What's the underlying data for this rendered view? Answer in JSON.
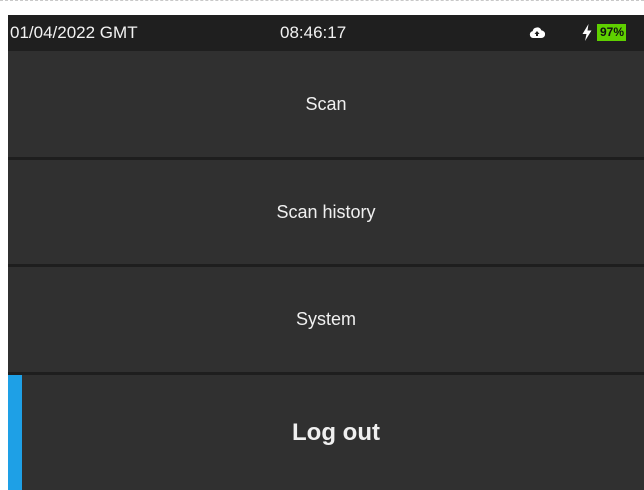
{
  "status_bar": {
    "date": "01/04/2022 GMT",
    "time": "08:46:17",
    "cloud_icon": "cloud-icon",
    "charging_icon": "lightning-bolt-icon",
    "battery_level": "97%",
    "battery_color": "#5fd000"
  },
  "menu": {
    "items": [
      {
        "label": "Scan"
      },
      {
        "label": "Scan history"
      },
      {
        "label": "System"
      },
      {
        "label": "Log out",
        "selected": true
      }
    ],
    "selection_color": "#1ea0e6"
  }
}
